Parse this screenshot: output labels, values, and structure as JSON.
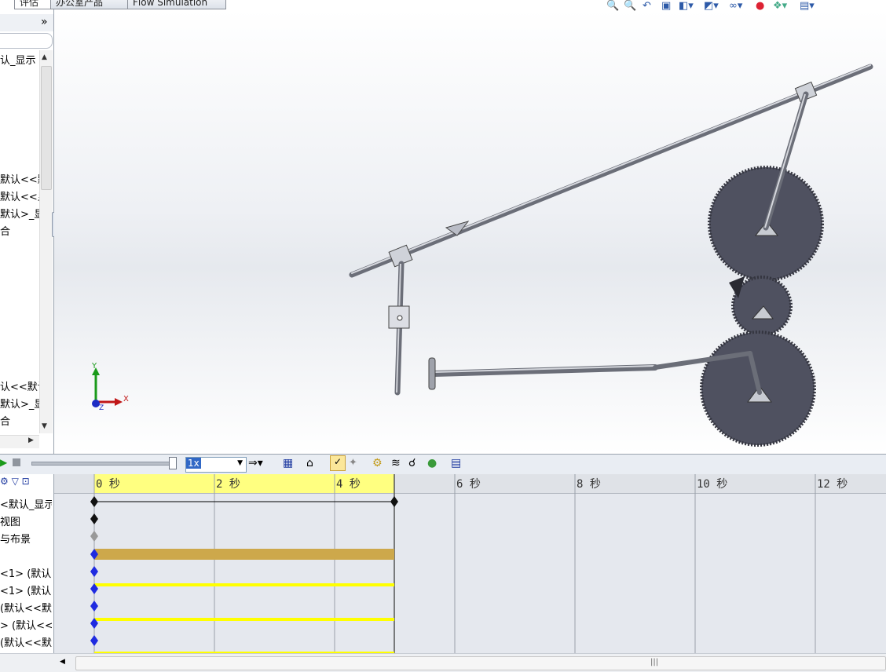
{
  "top_tabs": [
    "评估",
    "办公室产品",
    "Flow Simulation"
  ],
  "left_panel": {
    "chevron": "»",
    "items": [
      "认_显示",
      "默认<<默",
      "默认<<显",
      "默认>_显",
      "合",
      "认<<默认",
      "默认>_显",
      "合"
    ]
  },
  "viewport_toolbar_icons": [
    "zoom-to-fit-icon",
    "zoom-area-icon",
    "previous-view-icon",
    "section-view-icon",
    "view-orientation-icon",
    "display-style-icon",
    "hide-show-icon",
    "appearance-icon",
    "scene-icon",
    "view-settings-icon"
  ],
  "triad": {
    "y": "Y",
    "x": "X",
    "z": "Z"
  },
  "timeline_toolbar": {
    "speed_value": "1x",
    "icons": [
      "play-icon",
      "stop-icon",
      "playback-mode-icon",
      "save-animation-icon",
      "animation-wizard-icon",
      "autokey-icon",
      "add-key-icon",
      "motor-icon",
      "spring-icon",
      "contact-icon",
      "gravity-icon",
      "results-icon"
    ]
  },
  "timeline_tree": {
    "rows": [
      "<默认_显示",
      "视图",
      "与布景",
      "",
      "<1> (默认<",
      "<1> (默认<",
      "(默认<<默",
      "> (默认<<",
      "(默认<<默"
    ]
  },
  "ruler": {
    "labels": [
      "0 秒",
      "2 秒",
      "4 秒",
      "6 秒",
      "8 秒",
      "10 秒",
      "12 秒"
    ]
  },
  "colors": {
    "ruler_active": "#ffff80",
    "bar_gold": "#cda84b",
    "bar_yellow": "#ffff00",
    "key_blue": "#1f2be0",
    "gear": "#4f5160"
  }
}
